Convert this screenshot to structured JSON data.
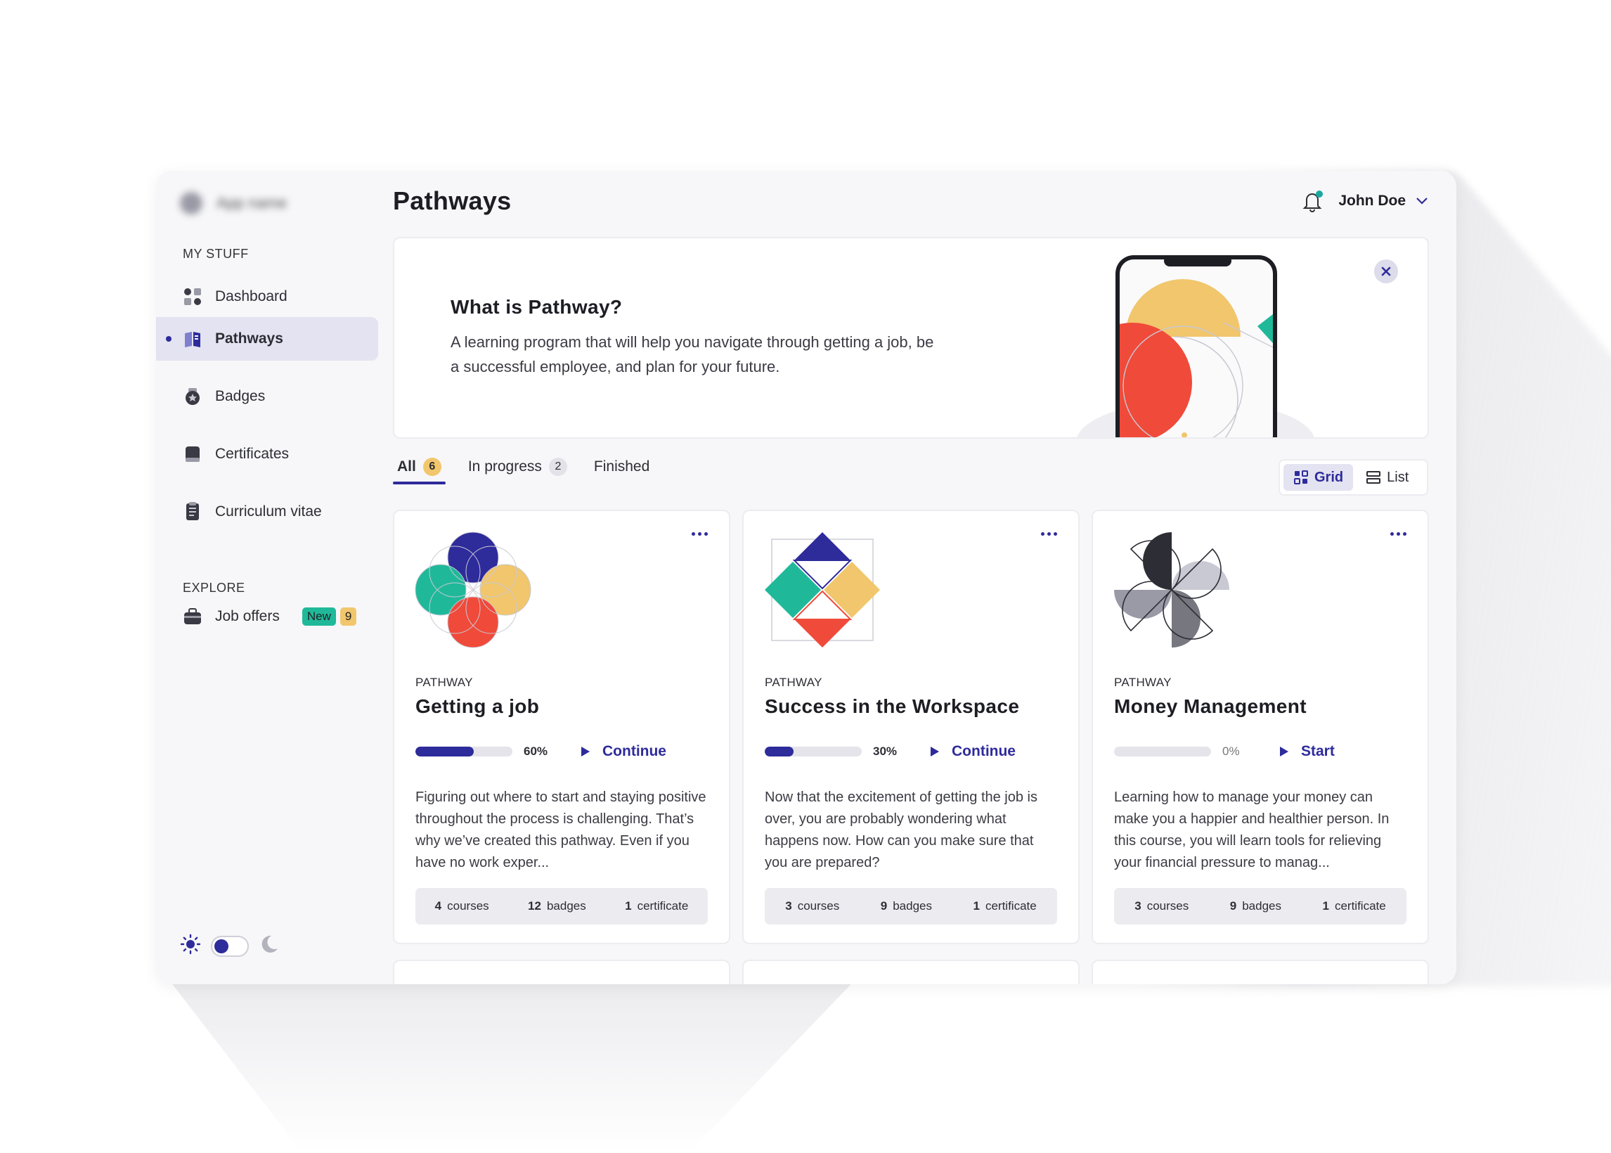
{
  "app": {
    "logo_text": "App name"
  },
  "sidebar": {
    "sections": {
      "my_stuff": "MY STUFF",
      "explore": "EXPLORE"
    },
    "items": [
      {
        "label": "Dashboard",
        "icon": "dashboard-icon"
      },
      {
        "label": "Pathways",
        "icon": "book-icon",
        "active": true
      },
      {
        "label": "Badges",
        "icon": "badge-icon"
      },
      {
        "label": "Certificates",
        "icon": "certificate-icon"
      },
      {
        "label": "Curriculum vitae",
        "icon": "document-icon"
      }
    ],
    "explore_items": [
      {
        "label": "Job offers",
        "icon": "briefcase-icon",
        "new_label": "New",
        "count": "9"
      }
    ],
    "theme": {
      "mode": "light"
    }
  },
  "header": {
    "title": "Pathways",
    "user_name": "John Doe",
    "has_notification": true
  },
  "banner": {
    "title": "What is Pathway?",
    "text": "A learning program that will help you navigate through getting a job, be a successful employee, and plan for your future."
  },
  "tabs": [
    {
      "label": "All",
      "count": "6",
      "active": true
    },
    {
      "label": "In progress",
      "count": "2"
    },
    {
      "label": "Finished",
      "count": ""
    }
  ],
  "view": {
    "grid_label": "Grid",
    "list_label": "List",
    "selected": "grid"
  },
  "cards": [
    {
      "kind": "PATHWAY",
      "title": "Getting a job",
      "progress": 60,
      "progress_label": "60%",
      "action": "Continue",
      "description": "Figuring out where to start and staying positive throughout the process is challenging. That’s why we’ve created this pathway. Even if you have no work exper...",
      "courses_count": "4",
      "courses_label": "courses",
      "badges_count": "12",
      "badges_label": "badges",
      "certificates_count": "1",
      "certificates_label": "certificate"
    },
    {
      "kind": "PATHWAY",
      "title": "Success in the Workspace",
      "progress": 30,
      "progress_label": "30%",
      "action": "Continue",
      "description": "Now that the excitement of getting the job is over, you are probably wondering what happens now. How can you make sure that you are prepared?",
      "courses_count": "3",
      "courses_label": "courses",
      "badges_count": "9",
      "badges_label": "badges",
      "certificates_count": "1",
      "certificates_label": "certificate"
    },
    {
      "kind": "PATHWAY",
      "title": "Money Management",
      "progress": 0,
      "progress_label": "0%",
      "action": "Start",
      "description": "Learning how to manage your money can make you a happier and healthier person. In this course, you will learn tools for relieving your financial pressure to manag...",
      "courses_count": "3",
      "courses_label": "courses",
      "badges_count": "9",
      "badges_label": "badges",
      "certificates_count": "1",
      "certificates_label": "certificate"
    }
  ],
  "colors": {
    "accent": "#2e2b9b",
    "teal": "#1fb99a",
    "yellow": "#f1c66c",
    "red": "#f04a3a",
    "active_bg": "#e3e3f1"
  }
}
